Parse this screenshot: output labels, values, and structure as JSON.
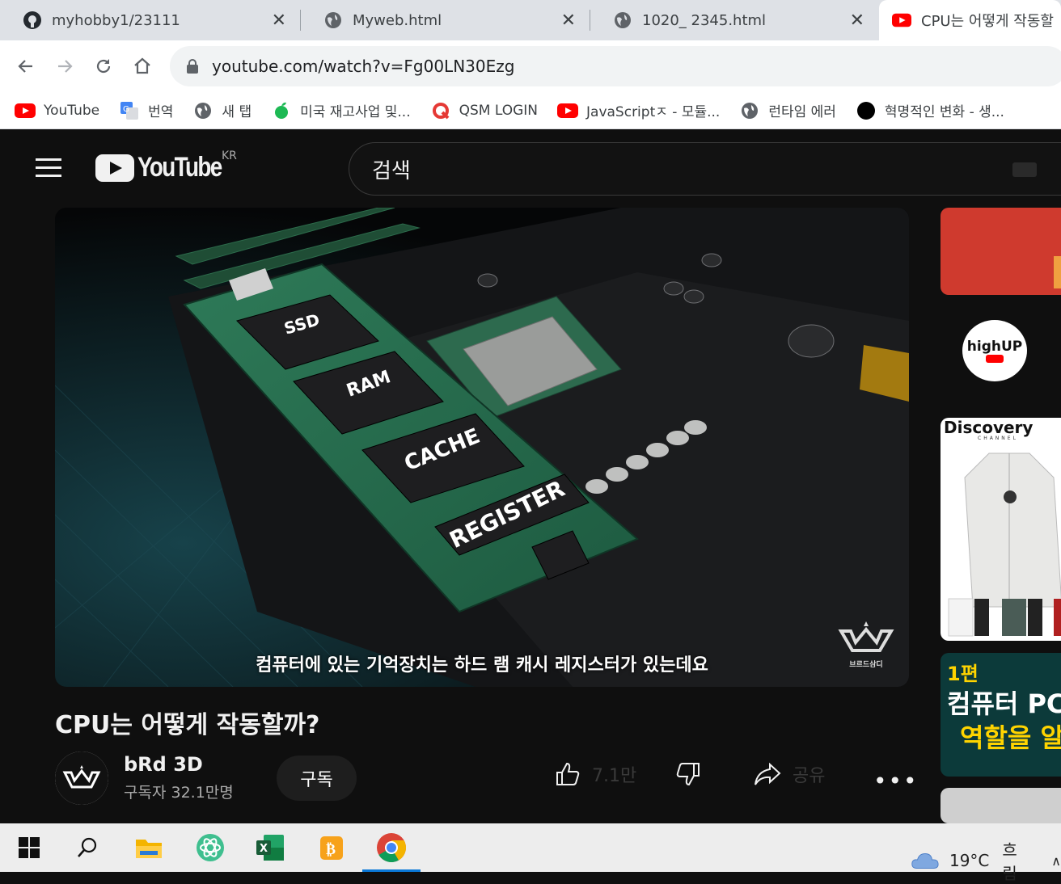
{
  "tabs": [
    {
      "title": "myhobby1/23111",
      "icon": "github-icon"
    },
    {
      "title": "Myweb.html",
      "icon": "globe-icon"
    },
    {
      "title": "1020_ 2345.html",
      "icon": "globe-icon"
    },
    {
      "title": "CPU는 어떻게 작동할",
      "icon": "youtube-icon",
      "active": true
    }
  ],
  "address": {
    "url": "youtube.com/watch?v=Fg00LN30Ezg"
  },
  "bookmarks": [
    {
      "label": "YouTube",
      "icon": "youtube-icon"
    },
    {
      "label": "번역",
      "icon": "translate-icon"
    },
    {
      "label": "새 탭",
      "icon": "globe-icon"
    },
    {
      "label": "미국 재고사업 및...",
      "icon": "apple-icon"
    },
    {
      "label": "QSM LOGIN",
      "icon": "q-icon"
    },
    {
      "label": "JavaScriptㅈ - 모듈...",
      "icon": "youtube-icon"
    },
    {
      "label": "런타임 에러",
      "icon": "globe-icon"
    },
    {
      "label": "혁명적인 변화 - 생...",
      "icon": "dot-icon"
    }
  ],
  "youtube": {
    "logo_text": "YouTube",
    "region": "KR",
    "search_placeholder": "검색",
    "video": {
      "subtitle": "컴퓨터에 있는 기억장치는 하드 램 캐시 레지스터가 있는데요",
      "chip_labels": [
        "SSD",
        "RAM",
        "CACHE",
        "REGISTER"
      ],
      "title": "CPU는 어떻게 작동할까?",
      "channel": "bRd 3D",
      "subscribers": "구독자 32.1만명",
      "subscribe_label": "구독",
      "likes": "7.1만",
      "share_label": "공유",
      "watermark": "브르드삼디"
    },
    "sidebar": {
      "channel_text": "highUP",
      "ad_brand": "Discovery",
      "ad_brand_sub": "CHANNEL",
      "thumb_badge": "1편",
      "thumb_line1": "컴퓨터 PC",
      "thumb_line2": "역할을 알"
    }
  },
  "taskbar": {
    "weather_temp": "19°C",
    "weather_text": "흐림",
    "apps": [
      "start-icon",
      "search-icon",
      "file-explorer-icon",
      "atom-icon",
      "excel-icon",
      "bitcoin-wallet-icon",
      "chrome-icon"
    ]
  },
  "colors": {
    "youtube_red": "#ff0000",
    "taskbar_accent": "#0a78d7",
    "page_bg": "#0f0f0f"
  }
}
